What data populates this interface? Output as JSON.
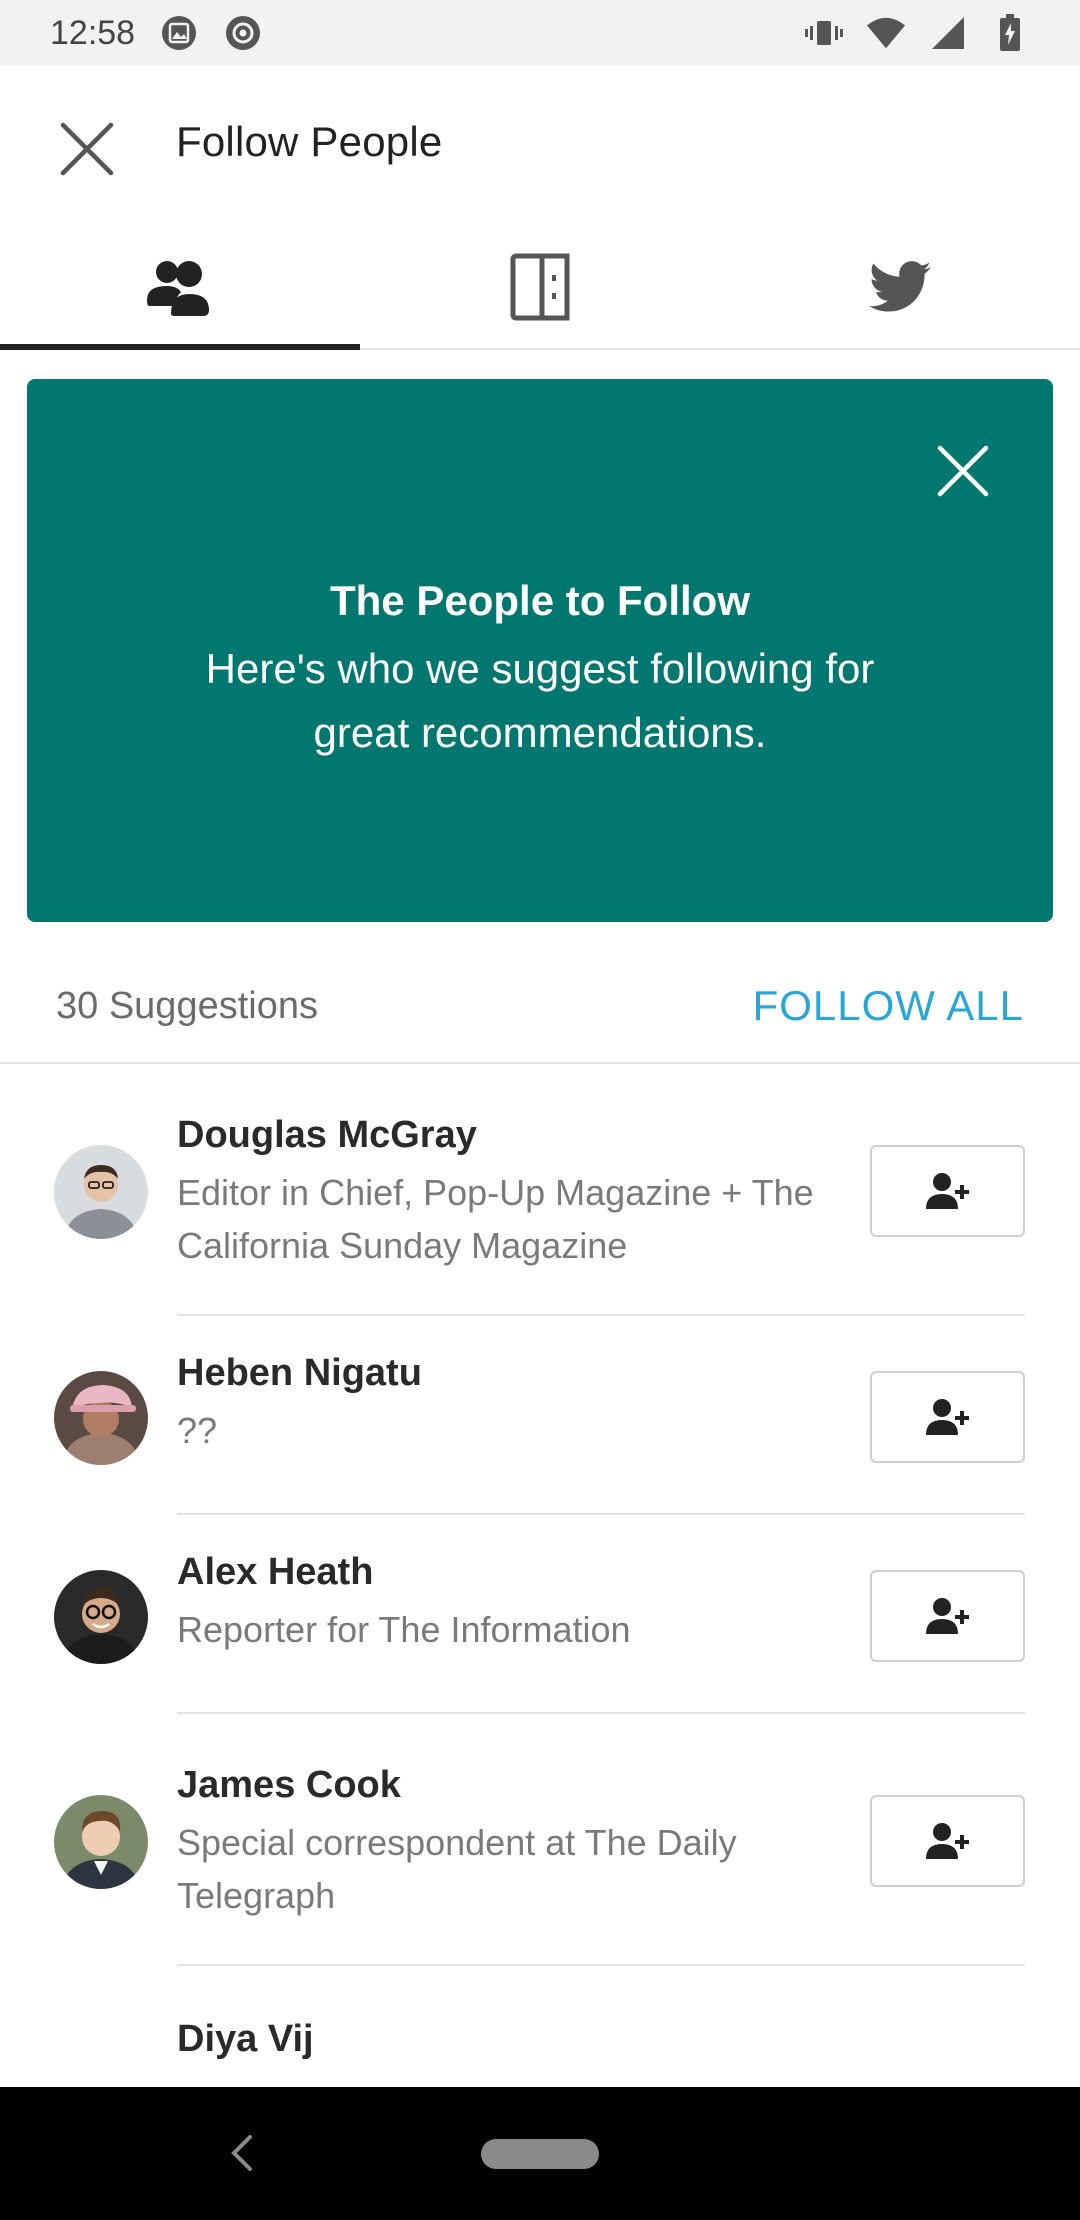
{
  "status_bar": {
    "time": "12:58"
  },
  "app_bar": {
    "title": "Follow People"
  },
  "tabs": [
    {
      "icon": "people-icon"
    },
    {
      "icon": "publication-icon"
    },
    {
      "icon": "twitter-icon"
    }
  ],
  "banner": {
    "title": "The People to Follow",
    "body": "Here's who we suggest following for great recommendations."
  },
  "suggestions": {
    "count_label": "30 Suggestions",
    "follow_all_label": "FOLLOW ALL"
  },
  "people": [
    {
      "name": "Douglas McGray",
      "description": "Editor in Chief, Pop-Up Magazine + The California Sunday Magazine"
    },
    {
      "name": "Heben Nigatu",
      "description": "??"
    },
    {
      "name": "Alex Heath",
      "description": "Reporter for The Information"
    },
    {
      "name": "James Cook",
      "description": "Special correspondent at The Daily Telegraph"
    },
    {
      "name": "Diya Vij",
      "description": ""
    }
  ],
  "colors": {
    "banner": "#027770",
    "accent": "#2aa6d6"
  }
}
